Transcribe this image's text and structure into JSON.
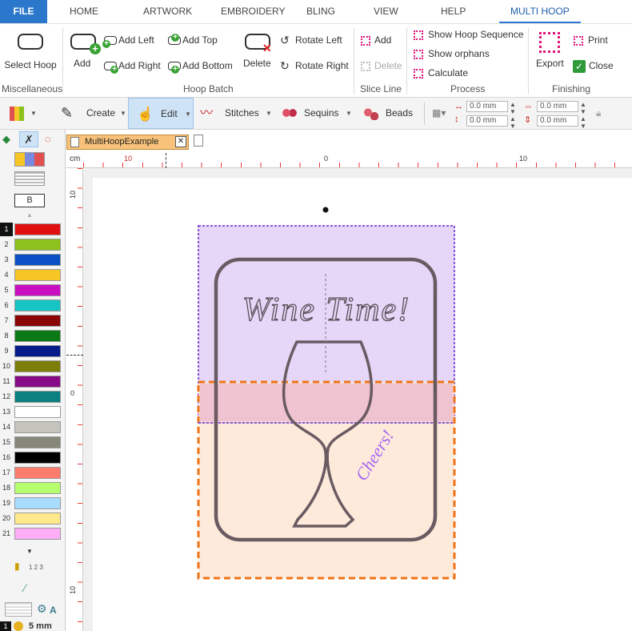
{
  "menu": {
    "file": "FILE",
    "home": "HOME",
    "artwork": "ARTWORK",
    "embroidery": "EMBROIDERY",
    "bling": "BLING",
    "view": "VIEW",
    "help": "HELP",
    "multi_hoop": "MULTI HOOP"
  },
  "ribbon": {
    "select_hoop": "Select Hoop",
    "misc_label": "Miscellaneous",
    "add": "Add",
    "add_left": "Add Left",
    "add_right": "Add Right",
    "add_top": "Add Top",
    "add_bottom": "Add Bottom",
    "delete": "Delete",
    "rotate_left": "Rotate Left",
    "rotate_right": "Rotate Right",
    "hoop_batch_label": "Hoop Batch",
    "slice_add": "Add",
    "slice_delete": "Delete",
    "slice_label": "Slice Line",
    "show_hoop_sequence": "Show Hoop Sequence",
    "show_orphans": "Show orphans",
    "calculate": "Calculate",
    "process_label": "Process",
    "export": "Export",
    "print": "Print",
    "close": "Close",
    "finishing_label": "Finishing"
  },
  "toolbar": {
    "create": "Create",
    "edit": "Edit",
    "stitches": "Stitches",
    "sequins": "Sequins",
    "beads": "Beads",
    "pos_x": "0.0 mm",
    "pos_y": "0.0 mm",
    "size_w": "0.0 mm",
    "size_h": "0.0 mm"
  },
  "left": {
    "b_label": "B",
    "swatches": [
      {
        "n": "1",
        "c": "#e01010"
      },
      {
        "n": "2",
        "c": "#8cc21b"
      },
      {
        "n": "3",
        "c": "#0a4fc4"
      },
      {
        "n": "4",
        "c": "#f7c624"
      },
      {
        "n": "5",
        "c": "#c90fc0"
      },
      {
        "n": "6",
        "c": "#17c4c4"
      },
      {
        "n": "7",
        "c": "#8a0606"
      },
      {
        "n": "8",
        "c": "#0b7a16"
      },
      {
        "n": "9",
        "c": "#061c8a"
      },
      {
        "n": "10",
        "c": "#7d7d0a"
      },
      {
        "n": "11",
        "c": "#870a87"
      },
      {
        "n": "12",
        "c": "#0a8080"
      },
      {
        "n": "13",
        "c": "#ffffff"
      },
      {
        "n": "14",
        "c": "#c4c4bd"
      },
      {
        "n": "15",
        "c": "#878779"
      },
      {
        "n": "16",
        "c": "#000000"
      },
      {
        "n": "17",
        "c": "#ff7b6e"
      },
      {
        "n": "18",
        "c": "#b5ff6e"
      },
      {
        "n": "19",
        "c": "#a8dcff"
      },
      {
        "n": "20",
        "c": "#ffe98a"
      },
      {
        "n": "21",
        "c": "#ffaef7"
      }
    ],
    "order_label": "1 2 3",
    "bottom_num": "1",
    "size_label": "5 mm",
    "a_label": "A"
  },
  "document": {
    "tab_name": "MultiHoopExample"
  },
  "ruler": {
    "unit": "cm",
    "h_labels": [
      "10",
      "0",
      "10"
    ],
    "v_labels": [
      "10",
      "0",
      "10"
    ]
  },
  "design": {
    "title_text": "Wine Time!",
    "cheers_text": "Cheers!",
    "hoop1_color": "#e6d6f8",
    "hoop2_color": "#fde3ce",
    "hoop1_border": "#8a55d6",
    "hoop2_border": "#f07318"
  }
}
